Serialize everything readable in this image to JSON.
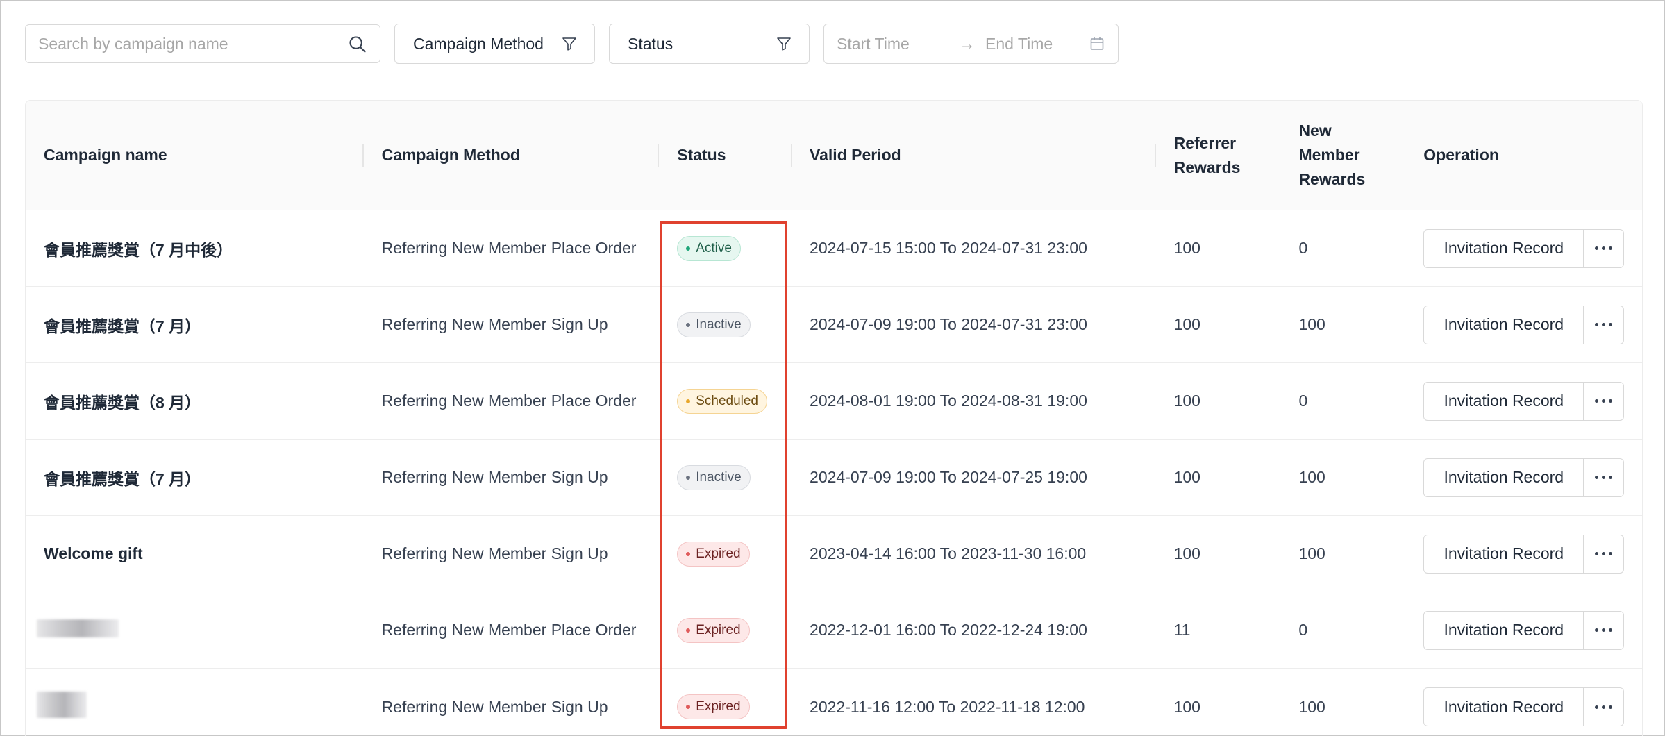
{
  "filters": {
    "search_placeholder": "Search by campaign name",
    "method_label": "Campaign Method",
    "status_label": "Status",
    "start_placeholder": "Start Time",
    "arrow": "→",
    "end_placeholder": "End Time"
  },
  "table": {
    "headers": {
      "name": "Campaign name",
      "method": "Campaign Method",
      "status": "Status",
      "period": "Valid Period",
      "referrer_l1": "Referrer",
      "referrer_l2": "Rewards",
      "member_l1": "New",
      "member_l2": "Member",
      "member_l3": "Rewards",
      "operation": "Operation"
    },
    "rows": [
      {
        "name": "會員推薦獎賞（7 月中後）",
        "method": "Referring New Member Place Order",
        "status": "Active",
        "period": "2024-07-15 15:00 To 2024-07-31 23:00",
        "referrer": "100",
        "member": "0",
        "op": "Invitation Record"
      },
      {
        "name": "會員推薦獎賞（7 月）",
        "method": "Referring New Member Sign Up",
        "status": "Inactive",
        "period": "2024-07-09 19:00 To 2024-07-31 23:00",
        "referrer": "100",
        "member": "100",
        "op": "Invitation Record"
      },
      {
        "name": "會員推薦獎賞（8 月）",
        "method": "Referring New Member Place Order",
        "status": "Scheduled",
        "period": "2024-08-01 19:00 To 2024-08-31 19:00",
        "referrer": "100",
        "member": "0",
        "op": "Invitation Record"
      },
      {
        "name": "會員推薦獎賞（7 月）",
        "method": "Referring New Member Sign Up",
        "status": "Inactive",
        "period": "2024-07-09 19:00 To 2024-07-25 19:00",
        "referrer": "100",
        "member": "100",
        "op": "Invitation Record"
      },
      {
        "name": "Welcome gift",
        "method": "Referring New Member Sign Up",
        "status": "Expired",
        "period": "2023-04-14 16:00 To 2023-11-30 16:00",
        "referrer": "100",
        "member": "100",
        "op": "Invitation Record"
      },
      {
        "name": "",
        "method": "Referring New Member Place Order",
        "status": "Expired",
        "period": "2022-12-01 16:00 To 2022-12-24 19:00",
        "referrer": "11",
        "member": "0",
        "op": "Invitation Record"
      },
      {
        "name": "",
        "method": "Referring New Member Sign Up",
        "status": "Expired",
        "period": "2022-11-16 12:00 To 2022-11-18 12:00",
        "referrer": "100",
        "member": "100",
        "op": "Invitation Record"
      }
    ]
  },
  "icons": {
    "search": "search-icon",
    "filter": "filter-icon",
    "calendar": "calendar-icon",
    "more": "more-dots-icon"
  },
  "colors": {
    "highlight": "#e0412f",
    "active": "#1fa67a",
    "scheduled": "#e8a72b",
    "expired": "#e05b5b",
    "inactive": "#6b7280"
  }
}
